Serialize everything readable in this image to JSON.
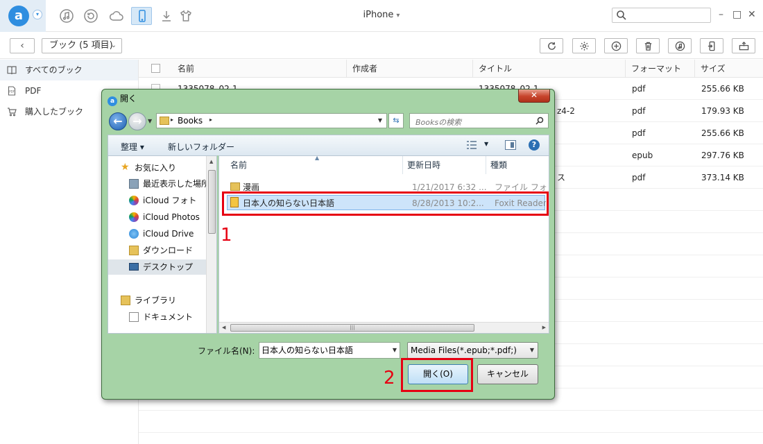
{
  "app": {
    "device_title": "iPhone",
    "logo_letter": "a",
    "nav_icons": [
      "music-icon",
      "restore-icon",
      "cloud-icon",
      "phone-icon",
      "download-icon",
      "tshirt-icon"
    ],
    "search_placeholder": ""
  },
  "toolbar": {
    "back_symbol": "‹",
    "folder_label": "ブック (5 項目)",
    "buttons": [
      "refresh-icon",
      "settings-icon",
      "add-icon",
      "delete-icon",
      "to-itunes-icon",
      "to-device-icon",
      "to-computer-icon"
    ]
  },
  "sidebar": {
    "items": [
      {
        "label": "すべてのブック",
        "icon": "book-icon"
      },
      {
        "label": "PDF",
        "icon": "pdf-icon"
      },
      {
        "label": "購入したブック",
        "icon": "cart-icon"
      }
    ]
  },
  "table": {
    "columns": [
      "名前",
      "作成者",
      "タイトル",
      "フォーマット",
      "サイズ"
    ],
    "rows": [
      {
        "name": "1335078_02-1",
        "author": "",
        "title": "1335078_02-1",
        "format": "pdf",
        "size": "255.66 KB"
      },
      {
        "name": "",
        "author": "",
        "title": "z4-2",
        "format": "pdf",
        "size": "179.93 KB"
      },
      {
        "name": "",
        "author": "",
        "title": "",
        "format": "pdf",
        "size": "255.66 KB"
      },
      {
        "name": "",
        "author": "",
        "title": "",
        "format": "epub",
        "size": "297.76 KB"
      },
      {
        "name": "",
        "author": "",
        "title": "ス",
        "format": "pdf",
        "size": "373.14 KB"
      }
    ]
  },
  "dialog": {
    "title": "開く",
    "close_symbol": "✕",
    "address": "Books",
    "search_placeholder": "Booksの検索",
    "organize_label": "整理 ▾",
    "new_folder_label": "新しいフォルダー",
    "nav_items": [
      {
        "label": "お気に入り",
        "icon": "star-icon"
      },
      {
        "label": "最近表示した場所",
        "icon": "recent-places-icon"
      },
      {
        "label": "iCloud フォト",
        "icon": "icloud-photos-icon"
      },
      {
        "label": "iCloud Photos",
        "icon": "icloud-photos-icon"
      },
      {
        "label": "iCloud Drive",
        "icon": "icloud-drive-icon"
      },
      {
        "label": "ダウンロード",
        "icon": "downloads-icon"
      },
      {
        "label": "デスクトップ",
        "icon": "desktop-icon"
      },
      {
        "label": "ライブラリ",
        "icon": "library-icon"
      },
      {
        "label": "ドキュメント",
        "icon": "documents-icon"
      }
    ],
    "file_columns": [
      "名前",
      "更新日時",
      "種類"
    ],
    "files": [
      {
        "name": "漫画",
        "date": "1/21/2017 6:32 ...",
        "type": "ファイル フォ",
        "icon": "folder-icon"
      },
      {
        "name": "日本人の知らない日本語",
        "date": "8/28/2013 10:2...",
        "type": "Foxit Reader",
        "icon": "pdf-file-icon"
      }
    ],
    "filename_label": "ファイル名(N):",
    "filename_value": "日本人の知らない日本語",
    "filetype_value": "Media Files(*.epub;*.pdf;)",
    "open_label": "開く(O)",
    "cancel_label": "キャンセル"
  },
  "annotations": {
    "step1": "1",
    "step2": "2",
    "color": "#e60012"
  }
}
